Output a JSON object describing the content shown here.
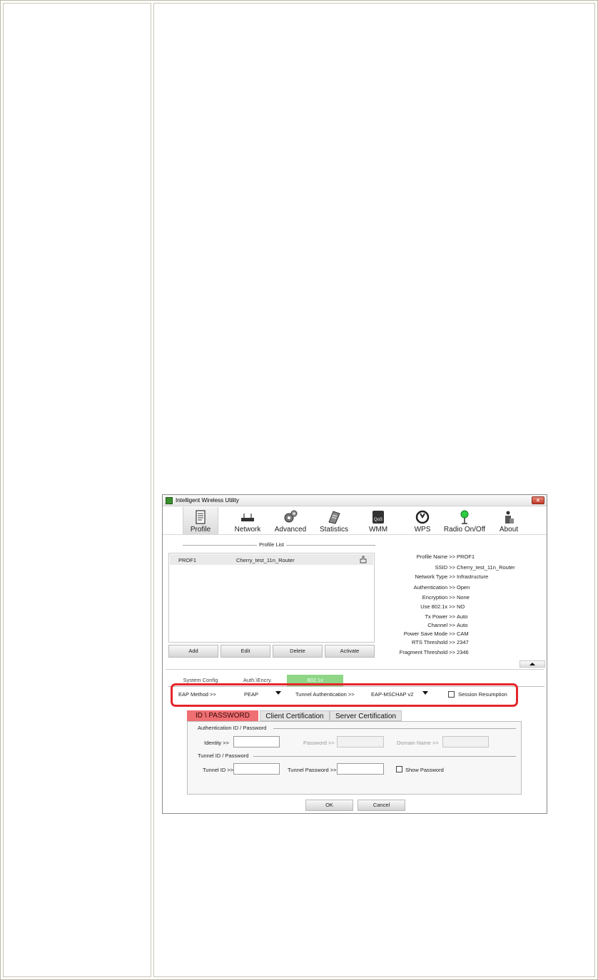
{
  "window": {
    "title": "Intelligent Wireless Utility",
    "close_label": "×"
  },
  "toolbar": {
    "items": [
      {
        "label": "Profile",
        "icon": "profile-icon",
        "active": true
      },
      {
        "label": "Network",
        "icon": "network-icon"
      },
      {
        "label": "Advanced",
        "icon": "advanced-gear-icon"
      },
      {
        "label": "Statistics",
        "icon": "statistics-icon"
      },
      {
        "label": "WMM",
        "icon": "wmm-qos-icon"
      },
      {
        "label": "WPS",
        "icon": "wps-icon"
      },
      {
        "label": "Radio On/Off",
        "icon": "radio-icon"
      },
      {
        "label": "About",
        "icon": "about-icon"
      }
    ]
  },
  "profile_list": {
    "legend": "Profile List",
    "rows": [
      {
        "name": "PROF1",
        "ssid": "Cherry_test_11n_Router"
      }
    ],
    "buttons": {
      "add": "Add",
      "edit": "Edit",
      "delete": "Delete",
      "activate": "Activate"
    }
  },
  "details": {
    "profile_name": {
      "label": "Profile Name >>",
      "value": "PROF1"
    },
    "ssid": {
      "label": "SSID >>",
      "value": "Cherry_test_11n_Router"
    },
    "network_type": {
      "label": "Network Type >>",
      "value": "Infrastructure"
    },
    "authentication": {
      "label": "Authentication >>",
      "value": "Open"
    },
    "encryption": {
      "label": "Encryption >>",
      "value": "None"
    },
    "use_8021x": {
      "label": "Use 802.1x >>",
      "value": "NO"
    },
    "tx_power": {
      "label": "Tx Power >>",
      "value": "Auto"
    },
    "channel": {
      "label": "Channel >>",
      "value": "Auto"
    },
    "power_save": {
      "label": "Power Save Mode >>",
      "value": "CAM"
    },
    "rts": {
      "label": "RTS Threshold >>",
      "value": "2347"
    },
    "fragment": {
      "label": "Fragment Threshold >>",
      "value": "2346"
    }
  },
  "settings_tabs": {
    "system_config": "System Config",
    "auth_encry": "Auth.\\Encry.",
    "dot1x": "802.1x"
  },
  "eap": {
    "method_label": "EAP Method >>",
    "method_value": "PEAP",
    "tunnel_label": "Tunnel Authentication >>",
    "tunnel_value": "EAP-MSCHAP v2",
    "session_label": "Session Resumption"
  },
  "cert_tabs": {
    "id_password": "ID \\ PASSWORD",
    "client_cert": "Client Certification",
    "server_cert": "Server Certification"
  },
  "auth": {
    "legend": "Authentication ID / Password",
    "identity_label": "Identity >>",
    "password_label": "Password >>",
    "domain_label": "Domain Name >>"
  },
  "tunnel": {
    "legend": "Tunnel ID / Password",
    "id_label": "Tunnel ID >>",
    "password_label": "Tunnel Password >>",
    "show_password_label": "Show Password"
  },
  "dialog_buttons": {
    "ok": "OK",
    "cancel": "Cancel"
  }
}
